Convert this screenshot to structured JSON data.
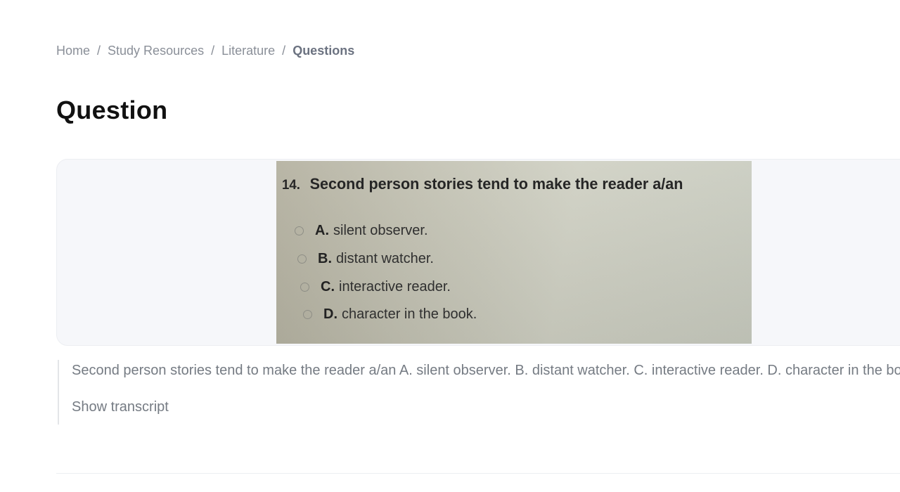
{
  "breadcrumb": {
    "items": [
      "Home",
      "Study Resources",
      "Literature"
    ],
    "current": "Questions",
    "separator": "/"
  },
  "page": {
    "title": "Question"
  },
  "question_image": {
    "number": "14.",
    "question": "Second person stories tend to make the reader a/an",
    "options": [
      {
        "letter": "A.",
        "text": "silent observer."
      },
      {
        "letter": "B.",
        "text": "distant watcher."
      },
      {
        "letter": "C.",
        "text": "interactive reader."
      },
      {
        "letter": "D.",
        "text": "character in the book."
      }
    ]
  },
  "transcript": {
    "text": "Second person stories tend to make the reader a/an A. silent observer. B. distant watcher. C. interactive reader. D. character in the book.",
    "toggle_label": "Show transcript"
  }
}
